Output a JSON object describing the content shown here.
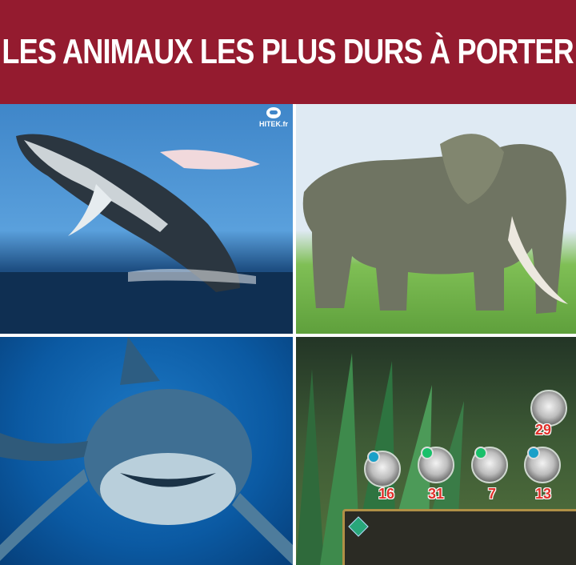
{
  "header": {
    "title": "LES ANIMAUX LES PLUS DURS À PORTER"
  },
  "watermark": {
    "text": "HITEK.fr"
  },
  "colors": {
    "banner": "#941b2f",
    "title_text": "#ffffff",
    "level_text": "#e0312b"
  },
  "panels": [
    {
      "subject": "humpback-whale"
    },
    {
      "subject": "elephant"
    },
    {
      "subject": "great-white-shark"
    },
    {
      "subject": "game-screenshot"
    }
  ],
  "game": {
    "levels": [
      "29",
      "16",
      "31",
      "7",
      "13"
    ]
  }
}
